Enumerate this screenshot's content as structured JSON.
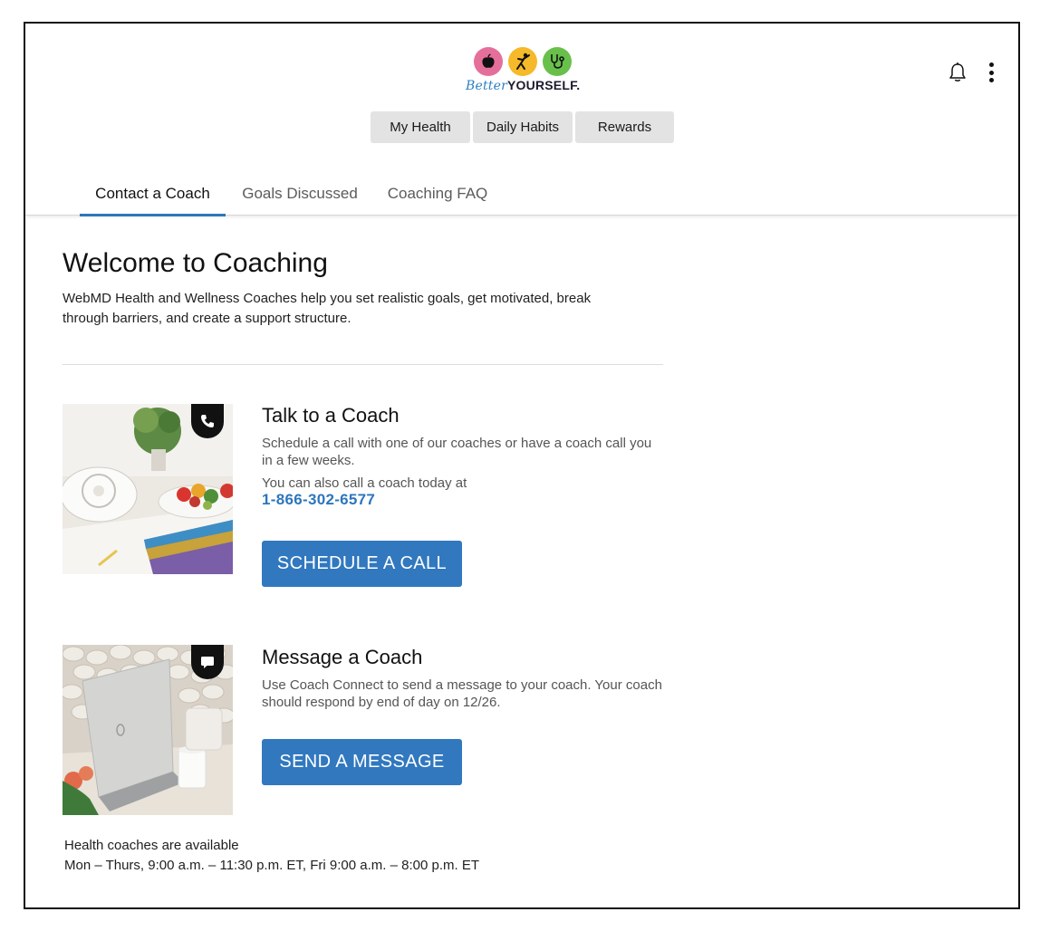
{
  "header": {
    "logo": {
      "word1": "Better",
      "word2": "YOURSELF",
      "suffix": "."
    },
    "nav_buttons": [
      {
        "label": "My Health"
      },
      {
        "label": "Daily Habits"
      },
      {
        "label": "Rewards"
      }
    ],
    "icons": [
      "bell-icon",
      "kebab-menu-icon"
    ]
  },
  "tabs": [
    {
      "label": "Contact a Coach",
      "active": true
    },
    {
      "label": "Goals Discussed",
      "active": false
    },
    {
      "label": "Coaching FAQ",
      "active": false
    }
  ],
  "main": {
    "title": "Welcome to Coaching",
    "description": "WebMD Health and Wellness Coaches help you set realistic goals, get motivated, break through barriers, and create a support structure.",
    "cards": [
      {
        "title": "Talk to a Coach",
        "description": "Schedule a call with one of our coaches or have a coach call you in a few weeks.",
        "secondary": "You can also call a coach today at",
        "phone": "1-866-302-6577",
        "button": "SCHEDULE A CALL",
        "badge_icon": "phone-icon"
      },
      {
        "title": "Message a Coach",
        "description": "Use Coach Connect to send a message to your coach. Your coach should respond by end of day on 12/26.",
        "button": "SEND A MESSAGE",
        "badge_icon": "chat-icon"
      }
    ],
    "availability": {
      "line1": "Health coaches are available",
      "line2": "Mon – Thurs, 9:00 a.m. – 11:30 p.m. ET, Fri 9:00 a.m. – 8:00 p.m. ET"
    }
  },
  "colors": {
    "accent": "#2d76bb",
    "button": "#3178bf",
    "nav_button_bg": "#e3e3e3"
  }
}
